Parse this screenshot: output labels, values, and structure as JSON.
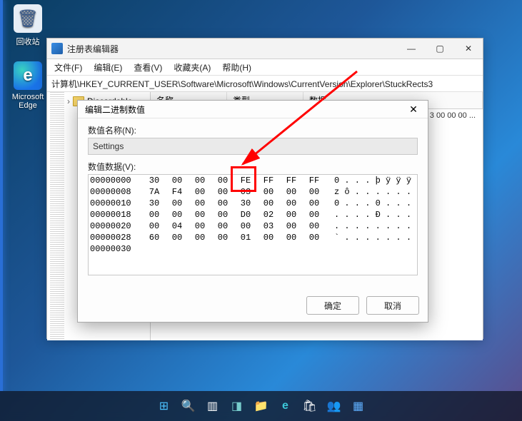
{
  "desktop": {
    "icons": [
      {
        "label": "回收站",
        "glyph": "🗑",
        "bg": "#e7eef6"
      },
      {
        "label": "Microsoft Edge",
        "glyph": "e",
        "bg": "#1a73e8"
      }
    ]
  },
  "regwin": {
    "title": "注册表编辑器",
    "menus": [
      "文件(F)",
      "编辑(E)",
      "查看(V)",
      "收藏夹(A)",
      "帮助(H)"
    ],
    "address": "计算机\\HKEY_CURRENT_USER\\Software\\Microsoft\\Windows\\CurrentVersion\\Explorer\\StuckRects3",
    "tree_folder": "Discardable",
    "columns": {
      "name": "名称",
      "type": "类型",
      "data": "数据"
    },
    "row_preview": "3 00 00 00 ...",
    "win_ctrl": {
      "min": "—",
      "max": "▢",
      "close": "✕"
    }
  },
  "dialog": {
    "title": "编辑二进制数值",
    "close": "✕",
    "name_label": "数值名称(N):",
    "name_value": "Settings",
    "data_label": "数值数据(V):",
    "ok": "确定",
    "cancel": "取消",
    "hex_rows": [
      {
        "off": "00000000",
        "b": [
          "30",
          "00",
          "00",
          "00",
          "FE",
          "FF",
          "FF",
          "FF"
        ],
        "asc": "0 . . . þ ÿ ÿ ÿ"
      },
      {
        "off": "00000008",
        "b": [
          "7A",
          "F4",
          "00",
          "00",
          "03",
          "00",
          "00",
          "00"
        ],
        "asc": "z ô . . . . . ."
      },
      {
        "off": "00000010",
        "b": [
          "30",
          "00",
          "00",
          "00",
          "30",
          "00",
          "00",
          "00"
        ],
        "asc": "0 . . . 0 . . ."
      },
      {
        "off": "00000018",
        "b": [
          "00",
          "00",
          "00",
          "00",
          "D0",
          "02",
          "00",
          "00"
        ],
        "asc": ". . . . Ð . . ."
      },
      {
        "off": "00000020",
        "b": [
          "00",
          "04",
          "00",
          "00",
          "00",
          "03",
          "00",
          "00"
        ],
        "asc": ". . . . . . . ."
      },
      {
        "off": "00000028",
        "b": [
          "60",
          "00",
          "00",
          "00",
          "01",
          "00",
          "00",
          "00"
        ],
        "asc": "` . . . . . . ."
      },
      {
        "off": "00000030",
        "b": [
          "",
          "",
          "",
          "",
          "",
          "",
          "",
          ""
        ],
        "asc": ""
      }
    ]
  },
  "taskbar": {
    "items": [
      {
        "name": "start",
        "glyph": "⊞",
        "color": "#4cc2ff"
      },
      {
        "name": "search",
        "glyph": "🔍",
        "color": "#fff"
      },
      {
        "name": "taskview",
        "glyph": "▥",
        "color": "#fff"
      },
      {
        "name": "widgets",
        "glyph": "◨",
        "color": "#7cc"
      },
      {
        "name": "explorer",
        "glyph": "📁",
        "color": "#ffcf5c"
      },
      {
        "name": "edge",
        "glyph": "e",
        "color": "#3cc8d9"
      },
      {
        "name": "store",
        "glyph": "🛍",
        "color": "#fff"
      },
      {
        "name": "teams",
        "glyph": "👥",
        "color": "#b9a6ff"
      },
      {
        "name": "regedit",
        "glyph": "▦",
        "color": "#5fb0ff"
      }
    ]
  }
}
